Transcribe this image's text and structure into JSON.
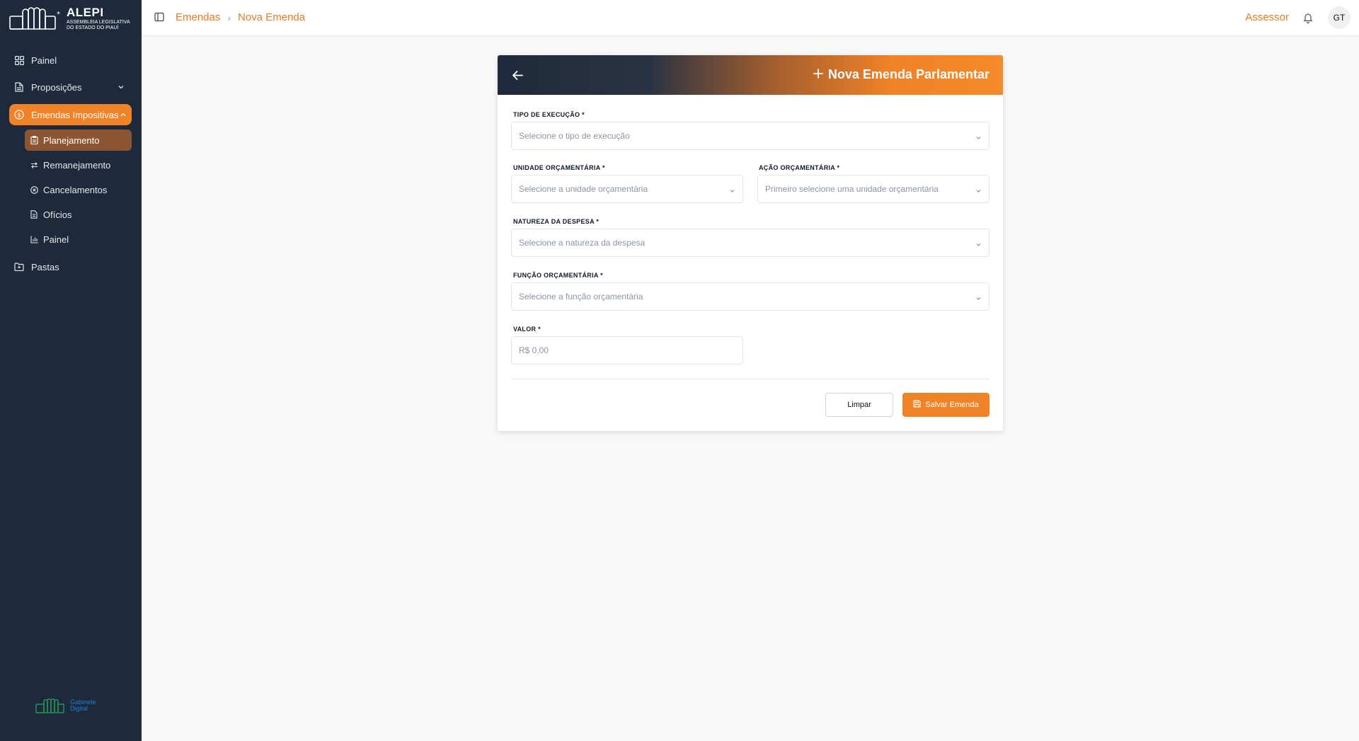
{
  "logo": {
    "title": "ALEPI",
    "subtitle_line1": "ASSEMBLEIA LEGISLATIVA",
    "subtitle_line2": "DO ESTADO DO PIAUÍ"
  },
  "sidebar": {
    "items": [
      {
        "label": "Painel",
        "icon": "grid-icon"
      },
      {
        "label": "Proposições",
        "icon": "document-icon",
        "expandable": true
      },
      {
        "label": "Emendas Impositivas",
        "icon": "dollar-circle-icon",
        "active": true,
        "expanded": true
      },
      {
        "label": "Pastas",
        "icon": "folder-icon"
      }
    ],
    "subitems": [
      {
        "label": "Planejamento",
        "icon": "clipboard-icon",
        "active": true
      },
      {
        "label": "Remanejamento",
        "icon": "arrows-swap-icon"
      },
      {
        "label": "Cancelamentos",
        "icon": "x-circle-icon"
      },
      {
        "label": "Ofícios",
        "icon": "file-text-icon"
      },
      {
        "label": "Painel",
        "icon": "bar-chart-icon"
      }
    ],
    "footer": {
      "line1": "Gabinete",
      "line2": "Digital"
    }
  },
  "header": {
    "breadcrumbs": [
      "Emendas",
      "Nova Emenda"
    ],
    "role": "Assessor",
    "avatar": "GT"
  },
  "form": {
    "title": "Nova Emenda Parlamentar",
    "fields": {
      "tipo_execucao": {
        "label": "TIPO DE EXECUÇÃO *",
        "placeholder": "Selecione o tipo de execução"
      },
      "unidade_orcamentaria": {
        "label": "UNIDADE ORÇAMENTÁRIA *",
        "placeholder": "Selecione a unidade orçamentária"
      },
      "acao_orcamentaria": {
        "label": "AÇÃO ORÇAMENTÁRIA *",
        "placeholder": "Primeiro selecione uma unidade orçamentária"
      },
      "natureza_despesa": {
        "label": "NATUREZA DA DESPESA *",
        "placeholder": "Selecione a natureza da despesa"
      },
      "funcao_orcamentaria": {
        "label": "FUNÇÃO ORÇAMENTÁRIA *",
        "placeholder": "Selecione a função orçamentária"
      },
      "valor": {
        "label": "VALOR *",
        "placeholder": "R$ 0,00",
        "value": ""
      }
    },
    "buttons": {
      "clear": "Limpar",
      "save": "Salvar Emenda"
    }
  },
  "colors": {
    "sidebar_bg": "#1e2a3b",
    "accent": "#f08228",
    "active_sub": "#8a5530",
    "link": "#ea7a1f"
  }
}
